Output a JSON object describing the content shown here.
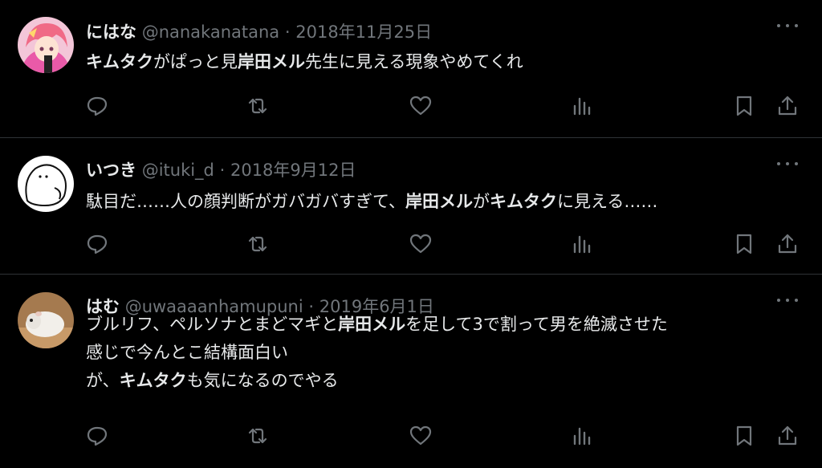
{
  "tweets": [
    {
      "name": "にはな",
      "handle": "@nanakanatana",
      "separator": "·",
      "date": "2018年11月25日",
      "lines": [
        [
          {
            "b": true,
            "t": "キムタク"
          },
          {
            "b": false,
            "t": "がぱっと見"
          },
          {
            "b": true,
            "t": "岸田メル"
          },
          {
            "b": false,
            "t": "先生に見える現象やめてくれ"
          }
        ]
      ]
    },
    {
      "name": "いつき",
      "handle": "@ituki_d",
      "separator": "·",
      "date": "2018年9月12日",
      "lines": [
        [
          {
            "b": false,
            "t": "駄目だ……人の顔判断がガバガバすぎて、"
          },
          {
            "b": true,
            "t": "岸田メル"
          },
          {
            "b": false,
            "t": "が"
          },
          {
            "b": true,
            "t": "キムタク"
          },
          {
            "b": false,
            "t": "に見える……"
          }
        ]
      ]
    },
    {
      "name": "はむ",
      "handle": "@uwaaaanhamupuni",
      "separator": "·",
      "date": "2019年6月1日",
      "lines": [
        [
          {
            "b": false,
            "t": "ブルリフ、ペルソナとまどマギと"
          },
          {
            "b": true,
            "t": "岸田メル"
          },
          {
            "b": false,
            "t": "を足して3で割って男を絶滅させた"
          }
        ],
        [
          {
            "b": false,
            "t": "感じで今んとこ結構面白い"
          }
        ],
        [
          {
            "b": false,
            "t": "が、"
          },
          {
            "b": true,
            "t": "キムタク"
          },
          {
            "b": false,
            "t": "も気になるのでやる"
          }
        ]
      ]
    }
  ],
  "icons": {
    "reply": "reply-icon",
    "retweet": "retweet-icon",
    "like": "heart-icon",
    "views": "views-icon",
    "bookmark": "bookmark-icon",
    "share": "share-icon",
    "more": "more-icon"
  },
  "colors": {
    "background": "#000000",
    "text": "#e7e9ea",
    "muted": "#71767b",
    "divider": "#2f3336"
  }
}
